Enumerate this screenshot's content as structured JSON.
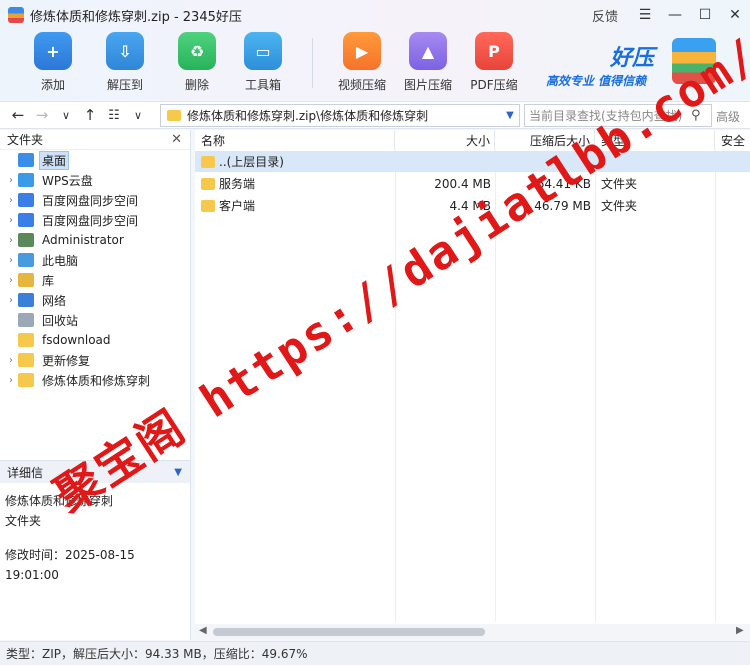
{
  "window": {
    "title": "修炼体质和修炼穿刺.zip - 2345好压",
    "feedback": "反馈",
    "menu_icon": "hamburger-icon",
    "minimize_icon": "minimize-icon",
    "maximize_icon": "maximize-icon",
    "close_icon": "close-icon"
  },
  "toolbar": {
    "add": "添加",
    "extract": "解压到",
    "delete": "删除",
    "toolbox": "工具箱",
    "video": "视频压缩",
    "image": "图片压缩",
    "pdf": "PDF压缩"
  },
  "brand": {
    "logo": "好压",
    "slogan": "高效专业 值得信赖"
  },
  "address": {
    "path": "修炼体质和修炼穿刺.zip\\修炼体质和修炼穿刺",
    "search_placeholder": "当前目录查找(支持包内查找)",
    "advanced": "高级"
  },
  "left": {
    "header": "文件夹",
    "tree": [
      {
        "label": "桌面",
        "icon": "desktop-icon",
        "chevron": false,
        "selected": true
      },
      {
        "label": "WPS云盘",
        "icon": "cloud-icon",
        "chevron": true
      },
      {
        "label": "百度网盘同步空间",
        "icon": "baidu-icon",
        "chevron": true
      },
      {
        "label": "百度网盘同步空间",
        "icon": "baidu-icon",
        "chevron": true
      },
      {
        "label": "Administrator",
        "icon": "user-icon",
        "chevron": true
      },
      {
        "label": "此电脑",
        "icon": "computer-icon",
        "chevron": true
      },
      {
        "label": "库",
        "icon": "library-icon",
        "chevron": true
      },
      {
        "label": "网络",
        "icon": "network-icon",
        "chevron": true
      },
      {
        "label": "回收站",
        "icon": "recycle-bin-icon",
        "chevron": false
      },
      {
        "label": "fsdownload",
        "icon": "folder-icon",
        "chevron": false
      },
      {
        "label": "更新修复",
        "icon": "folder-icon",
        "chevron": true
      },
      {
        "label": "修炼体质和修炼穿刺",
        "icon": "folder-icon",
        "chevron": true
      }
    ],
    "detail_header": "详细信",
    "detail_name": "修炼体质和修炼穿刺",
    "detail_type": "文件夹",
    "detail_mtime": "修改时间：2025-08-15 19:01:00"
  },
  "columns": {
    "name": "名称",
    "size": "大小",
    "packed": "压缩后大小",
    "type": "类型",
    "security": "安全"
  },
  "rows": [
    {
      "name": "..(上层目录)",
      "size": "",
      "packed": "",
      "type": ""
    },
    {
      "name": "服务端",
      "size": "200.4 MB",
      "packed": "64.41 KB",
      "type": "文件夹"
    },
    {
      "name": "客户端",
      "size": "4.4 MB",
      "packed": "46.79 MB",
      "type": "文件夹"
    }
  ],
  "status": "类型：ZIP，解压后大小：94.33 MB，压缩比：49.67%",
  "watermark": "聚宝阁 https://dajiatlbb.com/",
  "colors": {
    "accent": "#1a6fe0",
    "selection": "#d8e8f8",
    "watermark": "#e01818",
    "folder": "#f6c94c"
  }
}
